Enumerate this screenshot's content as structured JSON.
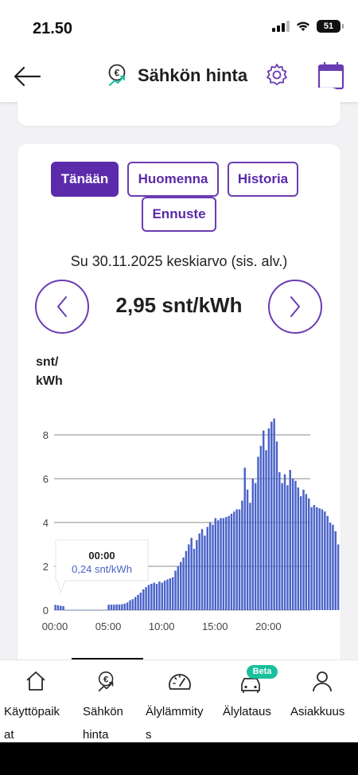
{
  "status_bar": {
    "time": "21.50",
    "battery": "51"
  },
  "header": {
    "title": "Sähkön hinta"
  },
  "tabs": [
    {
      "label": "Tänään",
      "active": true
    },
    {
      "label": "Huomenna",
      "active": false
    },
    {
      "label": "Historia",
      "active": false
    },
    {
      "label": "Ennuste",
      "active": false
    }
  ],
  "summary": {
    "date_label": "Su 30.11.2025 keskiarvo (sis. alv.)",
    "price": "2,95 snt/kWh"
  },
  "chart_unit": {
    "line1": "snt/",
    "line2": "kWh"
  },
  "tooltip": {
    "time": "00:00",
    "value": "0,24 snt/kWh"
  },
  "chart_data": {
    "type": "bar",
    "ylabel": "snt/kWh",
    "ylim": [
      0,
      9
    ],
    "yticks": [
      0,
      2,
      4,
      6,
      8
    ],
    "xticks": [
      "00:00",
      "05:00",
      "10:00",
      "15:00",
      "20:00"
    ],
    "interval": "15 min",
    "bar_color": "#4a63c8",
    "values": [
      0.24,
      0.22,
      0.2,
      0.18,
      0.01,
      0.01,
      0.01,
      0.01,
      0.01,
      0.01,
      0.01,
      0.01,
      0.01,
      0.01,
      0.01,
      0.01,
      0.01,
      0.01,
      0.01,
      0.01,
      0.25,
      0.25,
      0.25,
      0.26,
      0.26,
      0.27,
      0.3,
      0.35,
      0.45,
      0.5,
      0.6,
      0.7,
      0.8,
      0.95,
      1.05,
      1.15,
      1.2,
      1.25,
      1.2,
      1.3,
      1.25,
      1.35,
      1.4,
      1.45,
      1.5,
      1.8,
      2.0,
      2.2,
      2.4,
      2.7,
      3.0,
      3.3,
      2.8,
      3.2,
      3.5,
      3.7,
      3.4,
      3.8,
      4.0,
      3.9,
      4.2,
      4.1,
      4.2,
      4.2,
      4.25,
      4.3,
      4.4,
      4.5,
      4.6,
      4.6,
      5.0,
      6.5,
      5.5,
      4.9,
      6.0,
      5.8,
      7.0,
      7.5,
      8.2,
      7.3,
      8.3,
      8.6,
      8.75,
      7.7,
      6.3,
      5.8,
      6.2,
      5.7,
      6.4,
      6.0,
      5.9,
      5.6,
      5.2,
      5.5,
      5.3,
      5.1,
      4.7,
      4.8,
      4.7,
      4.65,
      4.6,
      4.5,
      4.3,
      4.0,
      3.9,
      3.6,
      3.0
    ]
  },
  "bottom_nav": [
    {
      "icon": "home-icon",
      "line1": "Käyttöpaik",
      "line2": "at"
    },
    {
      "icon": "euro-price-icon",
      "line1": "Sähkön",
      "line2": "hinta"
    },
    {
      "icon": "gauge-icon",
      "line1": "Älylämmity",
      "line2": "s"
    },
    {
      "icon": "car-charging-icon",
      "line1": "Älylataus",
      "line2": "",
      "badge": "Beta"
    },
    {
      "icon": "person-icon",
      "line1": "Asiakkuus",
      "line2": ""
    }
  ]
}
